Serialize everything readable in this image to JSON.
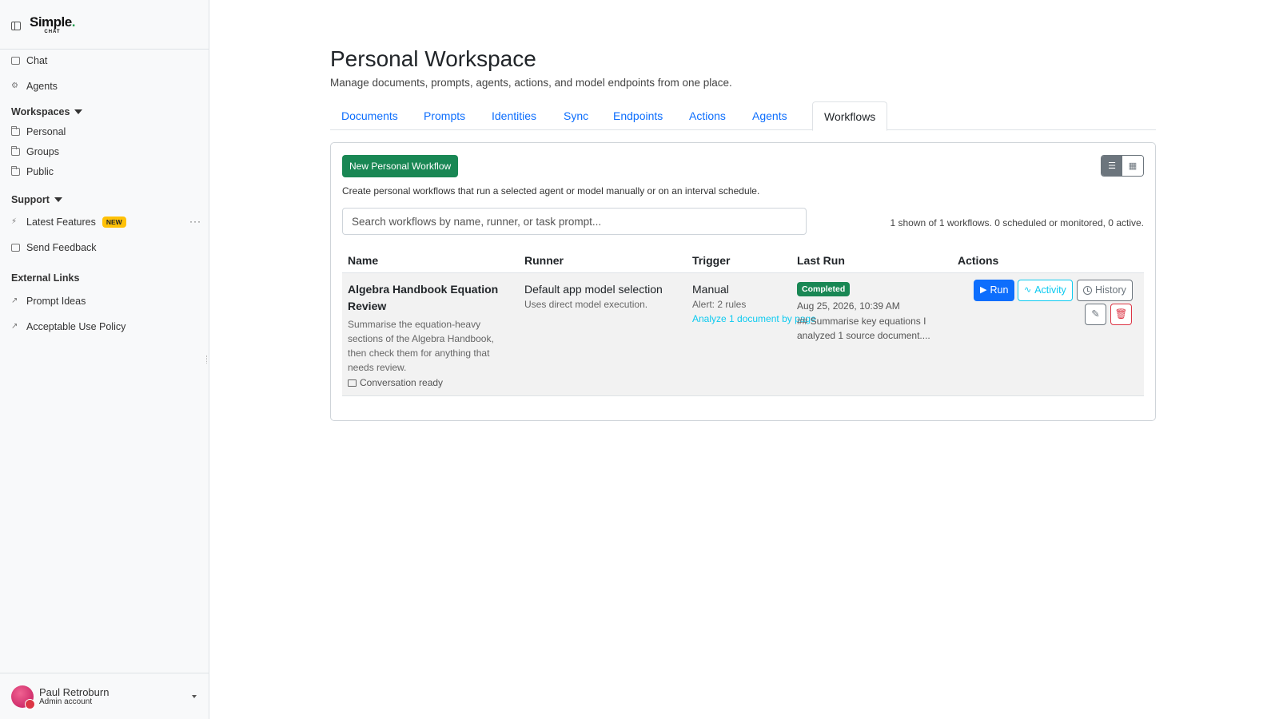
{
  "sidebar": {
    "logo": {
      "main": "Simple",
      "dot": ".",
      "sub": "CHAT"
    },
    "nav": [
      {
        "label": "Chat",
        "icon": "chat-icon"
      },
      {
        "label": "Agents",
        "icon": "agents-icon"
      }
    ],
    "workspaces": {
      "label": "Workspaces",
      "items": [
        {
          "label": "Personal",
          "icon": "folder-icon"
        },
        {
          "label": "Groups",
          "icon": "folder-icon"
        },
        {
          "label": "Public",
          "icon": "folder-icon"
        }
      ]
    },
    "support": {
      "label": "Support",
      "latest_features": "Latest Features",
      "new_badge": "NEW",
      "more": "···",
      "send_feedback": "Send Feedback"
    },
    "external": {
      "label": "External Links",
      "items": [
        {
          "label": "Prompt Ideas",
          "icon": "external-link-icon"
        },
        {
          "label": "Acceptable Use Policy",
          "icon": "external-link-icon"
        }
      ]
    },
    "user": {
      "name": "Paul Retroburn",
      "role": "Admin account"
    }
  },
  "header": {
    "title": "Personal Workspace",
    "subtitle": "Manage documents, prompts, agents, actions, and model endpoints from one place."
  },
  "tabs": [
    {
      "label": "Documents",
      "active": false
    },
    {
      "label": "Prompts",
      "active": false
    },
    {
      "label": "Identities",
      "active": false
    },
    {
      "label": "Sync",
      "active": false
    },
    {
      "label": "Endpoints",
      "active": false
    },
    {
      "label": "Actions",
      "active": false
    },
    {
      "label": "Agents",
      "active": false
    },
    {
      "label": "Workflows",
      "active": true
    }
  ],
  "workflows": {
    "new_button": "New Personal Workflow",
    "description": "Create personal workflows that run a selected agent or model manually or on an interval schedule.",
    "search_placeholder": "Search workflows by name, runner, or task prompt...",
    "count_text": "1 shown of 1 workflows. 0 scheduled or monitored, 0 active.",
    "view_modes": [
      "list-view-icon",
      "grid-view-icon"
    ],
    "columns": [
      "Name",
      "Runner",
      "Trigger",
      "Last Run",
      "Actions"
    ],
    "rows": [
      {
        "name": "Algebra Handbook Equation Review",
        "description": "Summarise the equation-heavy sections of the Algebra Handbook, then check them for anything that needs review.",
        "status": "Conversation ready",
        "runner": "Default app model selection",
        "runner_sub": "Uses direct model execution.",
        "trigger": "Manual",
        "trigger_sub": "Alert: 2 rules",
        "trigger_link": "Analyze 1 document by page",
        "last_run_badge": "Completed",
        "last_run_date": "Aug 25, 2026, 10:39 AM",
        "last_run_summary": "## Summarise key equations I analyzed 1 source document....",
        "actions": {
          "run": "Run",
          "activity": "Activity",
          "history": "History"
        }
      }
    ]
  },
  "colors": {
    "primary": "#0d6efd",
    "success": "#198754",
    "info": "#0dcaf0",
    "danger": "#dc3545",
    "secondary": "#6c757d",
    "badge_new": "#ffc107"
  }
}
